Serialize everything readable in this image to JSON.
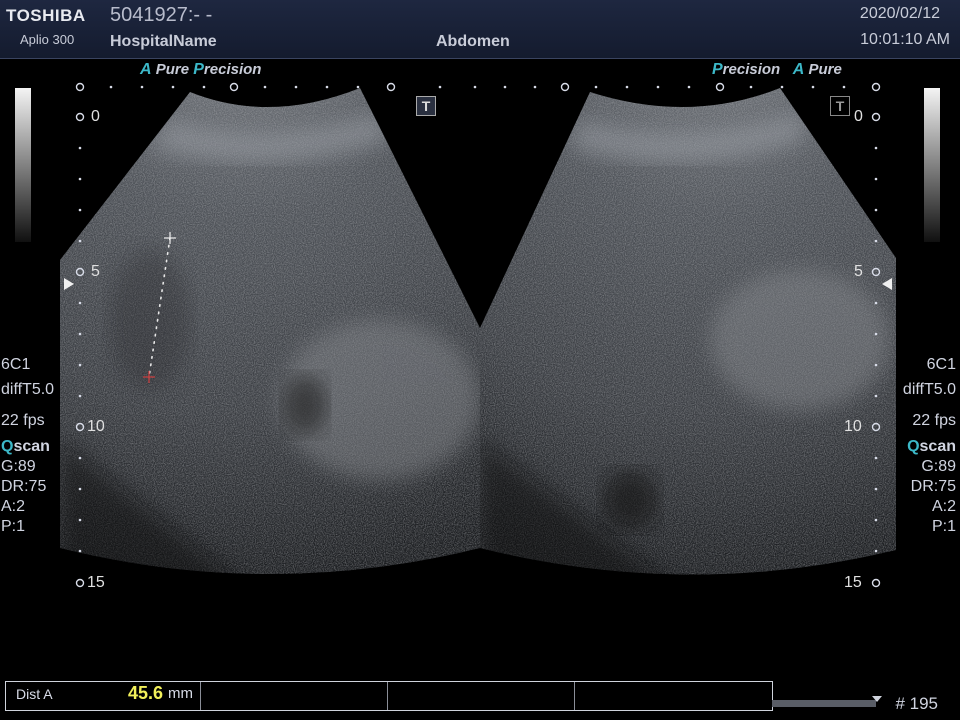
{
  "header": {
    "brand": "TOSHIBA",
    "model": "Aplio 300",
    "patient_id": "5041927:- -",
    "hospital": "HospitalName",
    "exam": "Abdomen",
    "date": "2020/02/12",
    "time": "10:01:10 AM"
  },
  "left_image": {
    "logo": {
      "a1": "A",
      "pure": " Pure ",
      "p": "P",
      "precision": "recision"
    },
    "depth_labels": [
      "0",
      "5",
      "10",
      "15"
    ],
    "params": {
      "transducer": "6C1",
      "mode": "diffT5.0",
      "fps": "22 fps",
      "qscan_q": "Q",
      "qscan_rest": "scan",
      "gain": "G:89",
      "dr": "DR:75",
      "a": "A:2",
      "p": "P:1"
    },
    "badge": "T"
  },
  "right_image": {
    "logo": {
      "p": "P",
      "precision": "recision",
      "a1": "A",
      "pure": " Pure"
    },
    "depth_labels": [
      "0",
      "5",
      "10",
      "15"
    ],
    "params": {
      "transducer": "6C1",
      "mode": "diffT5.0",
      "fps": "22 fps",
      "qscan_q": "Q",
      "qscan_rest": "scan",
      "gain": "G:89",
      "dr": "DR:75",
      "a": "A:2",
      "p": "P:1"
    },
    "badge": "T"
  },
  "measurement": {
    "label": "Dist A",
    "value": "45.6",
    "unit": "mm"
  },
  "footer": {
    "frame": "# 195"
  },
  "colors": {
    "accent": "#3cb8c8",
    "measure": "#f2f05a",
    "header_bg": "#1a2236"
  }
}
